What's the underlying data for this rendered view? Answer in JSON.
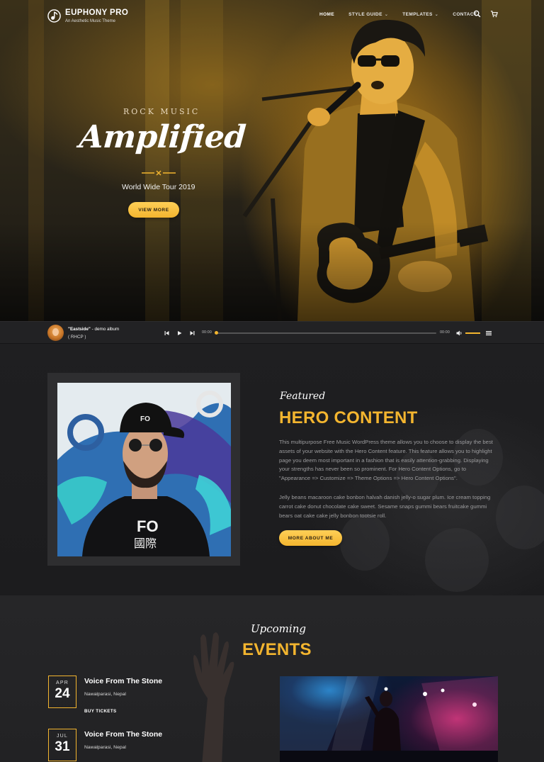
{
  "brand": {
    "name": "EUPHONY PRO",
    "tagline": "An Aesthetic Music Theme"
  },
  "nav": [
    {
      "label": "HOME",
      "active": true,
      "dropdown": false
    },
    {
      "label": "STYLE GUIDE",
      "active": false,
      "dropdown": true
    },
    {
      "label": "TEMPLATES",
      "active": false,
      "dropdown": true
    },
    {
      "label": "CONTACT",
      "active": false,
      "dropdown": false
    }
  ],
  "nav_icons": [
    "search-icon",
    "cart-icon"
  ],
  "hero": {
    "kicker": "ROCK MUSIC",
    "title": "Amplified",
    "subtitle": "World Wide Tour 2019",
    "button": "VIEW MORE"
  },
  "player": {
    "track_title": "\"Eastside\"",
    "album": " - demo album",
    "artist": "( RHCP )",
    "time_current": "00:00",
    "time_total": "00:00",
    "progress": 0,
    "volume": 1
  },
  "featured": {
    "script": "Featured",
    "title": "HERO CONTENT",
    "paragraph1": "This multipurpose Free Music WordPress theme allows you to choose to display the best assets of your website with the Hero Content feature. This feature allows you to highlight page you deem most important in a fashion that is easily attention-grabbing. Displaying your strengths has never been so prominent. For Hero Content Options, go to \"Appearance => Customize => Theme Options => Hero Content Options\".",
    "paragraph2": "Jelly beans macaroon cake bonbon halvah danish jelly-o sugar plum. Ice cream topping carrot cake donut chocolate cake sweet. Sesame snaps gummi bears fruitcake gummi bears oat cake cake jelly bonbon tootsie roll.",
    "button": "MORE ABOUT ME"
  },
  "events": {
    "script": "Upcoming",
    "title": "EVENTS",
    "items": [
      {
        "month": "APR",
        "day": "24",
        "name": "Voice From The Stone",
        "location": "Nawalparasi, Nepal",
        "action": "BUY TICKETS"
      },
      {
        "month": "JUL",
        "day": "31",
        "name": "Voice From The Stone",
        "location": "Nawalparasi, Nepal",
        "action": ""
      }
    ]
  },
  "colors": {
    "accent": "#f3b52f",
    "background": "#1c1c1e",
    "player": "#222224"
  }
}
